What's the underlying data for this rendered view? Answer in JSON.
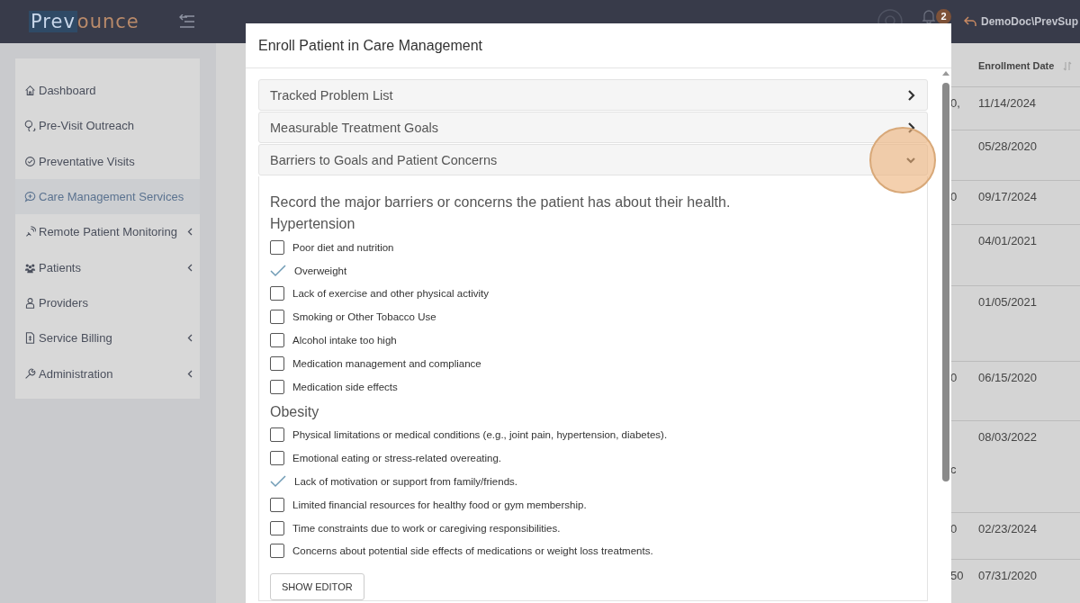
{
  "topbar": {
    "logo": {
      "part_1": "Prev",
      "part_2": "ounce"
    },
    "notification_count": "2",
    "user": "DemoDoc\\PrevSup"
  },
  "sidebar": {
    "items": [
      {
        "label": "Dashboard",
        "selected": false,
        "has_submenu": false
      },
      {
        "label": "Pre-Visit Outreach",
        "selected": false,
        "has_submenu": false
      },
      {
        "label": "Preventative Visits",
        "selected": false,
        "has_submenu": false
      },
      {
        "label": "Care Management Services",
        "selected": true,
        "has_submenu": false
      },
      {
        "label": "Remote Patient Monitoring",
        "selected": false,
        "has_submenu": true
      },
      {
        "label": "Patients",
        "selected": false,
        "has_submenu": true
      },
      {
        "label": "Providers",
        "selected": false,
        "has_submenu": false
      },
      {
        "label": "Service Billing",
        "selected": false,
        "has_submenu": true
      },
      {
        "label": "Administration",
        "selected": false,
        "has_submenu": true
      }
    ]
  },
  "table": {
    "columns": [
      {
        "label": "Enrollment Date"
      }
    ],
    "rows": [
      {
        "column_1": "0,",
        "enrollment_date": "11/14/2024"
      },
      {
        "enrollment_date": "05/28/2020"
      },
      {
        "column_1": "0",
        "enrollment_date": "09/17/2024"
      },
      {
        "enrollment_date": "04/01/2021"
      },
      {
        "enrollment_date": "01/05/2021"
      },
      {
        "column_1": "0",
        "enrollment_date": "06/15/2020"
      },
      {
        "column_1": "c",
        "enrollment_date": "08/03/2022"
      },
      {
        "column_1": "0",
        "enrollment_date": "02/23/2024"
      },
      {
        "column_1": "50",
        "enrollment_date": "07/31/2020"
      }
    ]
  },
  "modal": {
    "title": "Enroll Patient in Care Management",
    "panels": [
      {
        "title": "Tracked Problem List",
        "expanded": false,
        "highlighted": false
      },
      {
        "title": "Measurable Treatment Goals",
        "expanded": false,
        "highlighted": false
      },
      {
        "title": "Barriers to Goals and Patient Concerns",
        "expanded": true,
        "highlighted": true,
        "description": "Record the major barriers or concerns the patient has about their health.",
        "groups": [
          {
            "heading": "Hypertension",
            "items": [
              {
                "label": "Poor diet and nutrition",
                "checked": false
              },
              {
                "label": "Overweight",
                "checked": true
              },
              {
                "label": "Lack of exercise and other physical activity",
                "checked": false
              },
              {
                "label": "Smoking or Other Tobacco Use",
                "checked": false
              },
              {
                "label": "Alcohol intake too high",
                "checked": false
              },
              {
                "label": "Medication management and compliance",
                "checked": false
              },
              {
                "label": "Medication side effects",
                "checked": false
              }
            ]
          },
          {
            "heading": "Obesity",
            "items": [
              {
                "label": "Physical limitations or medical conditions (e.g., joint pain, hypertension, diabetes).",
                "checked": false
              },
              {
                "label": "Emotional eating or stress-related overeating.",
                "checked": false
              },
              {
                "label": "Lack of motivation or support from family/friends.",
                "checked": true
              },
              {
                "label": "Limited financial resources for healthy food or gym membership.",
                "checked": false
              },
              {
                "label": "Time constraints due to work or caregiving responsibilities.",
                "checked": false
              },
              {
                "label": "Concerns about potential side effects of medications or weight loss treatments.",
                "checked": false
              }
            ]
          }
        ],
        "button": "SHOW EDITOR"
      }
    ]
  }
}
